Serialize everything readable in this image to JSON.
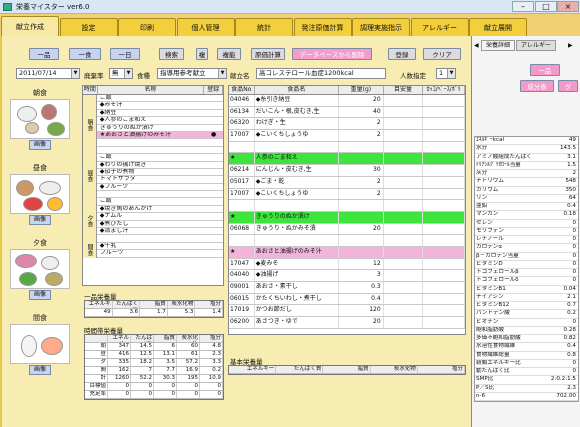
{
  "app": {
    "title": "栄養マイスター ver6.0",
    "min": "–",
    "max": "□",
    "close": "×"
  },
  "tabs": [
    "献立作成",
    "設定",
    "印刷",
    "個人管理",
    "統計",
    "発注原価計算",
    "調理実施指示",
    "アレルギー",
    "献立展開"
  ],
  "toolbar": {
    "b1": "一品",
    "b2": "一食",
    "b3": "一日",
    "b4": "検索",
    "b5": "複",
    "b6": "複能",
    "b7": "原価計算",
    "b8": "データベースから削除",
    "b9": "登録",
    "b10": "クリア"
  },
  "form": {
    "date": "2011/07/14",
    "waste_label": "廃棄率",
    "waste_val": "無",
    "type_label": "食種",
    "type_val": "指導用参考献立",
    "menu_label": "献立名",
    "menu_val": "高コレステロール血症1200kcal",
    "people_label": "人数指定",
    "people_val": "1"
  },
  "meals": [
    {
      "name": "朝食",
      "btn": "画像"
    },
    {
      "name": "昼食",
      "btn": "画像"
    },
    {
      "name": "夕食",
      "btn": "画像"
    },
    {
      "name": "間食",
      "btn": "画像"
    }
  ],
  "menu_grid": {
    "headers": [
      "時間",
      "名称",
      "登録"
    ],
    "groups": [
      "朝食",
      "昼食",
      "夕食",
      "間食"
    ],
    "rows": [
      "ご飯",
      "◆みそ汁",
      "◆納豆",
      "◆人参のごま和え",
      "きゅうりのぬか漬け",
      "★あおさと油揚げのみそ汁",
      "",
      "",
      "ご飯",
      "◆わりの揚げ焼き",
      "◆茄子の煮物",
      "トマトサラダ",
      "◆フルーツ",
      "",
      "ご飯",
      "◆焼き魚のあんかけ",
      "◆ナムル",
      "◆煮びたし",
      "◆清まし汁",
      "",
      "◆牛乳",
      "フルーツ"
    ]
  },
  "food_grid": {
    "headers": [
      "食品No",
      "食品名",
      "重量(g)",
      "目安量",
      "ｶｯｺ/ﾍﾞｰｽ/ﾎﾞﾘ"
    ],
    "rows": [
      {
        "no": "04046",
        "name": "◆糸引き納豆",
        "w": "20",
        "band": ""
      },
      {
        "no": "06134",
        "name": "だいこん・根,皮むき,生",
        "w": "40",
        "band": ""
      },
      {
        "no": "06320",
        "name": "わけぎ・生",
        "w": "2",
        "band": ""
      },
      {
        "no": "17007",
        "name": "◆こいくちしょうゆ",
        "w": "2",
        "band": ""
      },
      {
        "no": "",
        "name": "",
        "w": "",
        "band": ""
      },
      {
        "no": "★",
        "name": "人参のごま和え",
        "w": "",
        "band": "green"
      },
      {
        "no": "06214",
        "name": "にんじん・皮むき,生",
        "w": "30",
        "band": ""
      },
      {
        "no": "05017",
        "name": "◆ごま・乾",
        "w": "2",
        "band": ""
      },
      {
        "no": "17007",
        "name": "◆こいくちしょうゆ",
        "w": "2",
        "band": ""
      },
      {
        "no": "",
        "name": "",
        "w": "",
        "band": ""
      },
      {
        "no": "★",
        "name": "きゅうりのぬか漬け",
        "w": "",
        "band": "green"
      },
      {
        "no": "06068",
        "name": "きゅうり・ぬかみそ漬",
        "w": "20",
        "band": ""
      },
      {
        "no": "",
        "name": "",
        "w": "",
        "band": ""
      },
      {
        "no": "★",
        "name": "あおさと油揚げのみそ汁",
        "w": "",
        "band": "pink"
      },
      {
        "no": "17047",
        "name": "◆麦みそ",
        "w": "12",
        "band": ""
      },
      {
        "no": "04040",
        "name": "◆油揚げ",
        "w": "3",
        "band": ""
      },
      {
        "no": "09001",
        "name": "あおさ・素干し",
        "w": "0.3",
        "band": ""
      },
      {
        "no": "06015",
        "name": "かたくちいわし・煮干し",
        "w": "0.4",
        "band": ""
      },
      {
        "no": "17019",
        "name": "かつお節だし",
        "w": "120",
        "band": ""
      },
      {
        "no": "06200",
        "name": "あさつき・ゆで",
        "w": "20",
        "band": ""
      }
    ]
  },
  "ippin": {
    "title": "一品栄養量",
    "headers": [
      "エネルギー",
      "たんぱく質",
      "脂質",
      "炭水化物",
      "塩分"
    ],
    "values": [
      "49",
      "3.6",
      "1.7",
      "5.3",
      "1.4"
    ]
  },
  "jikan": {
    "title": "時間帯栄養量",
    "headers": [
      "",
      "エネルギー",
      "たんぱく質",
      "脂質",
      "炭水化物",
      "塩分"
    ],
    "rows": [
      [
        "朝",
        "347",
        "14.5",
        "6",
        "60",
        "4.8"
      ],
      [
        "昼",
        "416",
        "12.5",
        "13.1",
        "61",
        "2.3"
      ],
      [
        "夕",
        "335",
        "18.2",
        "3.5",
        "57.2",
        "3.3"
      ],
      [
        "間",
        "162",
        "7",
        "7.7",
        "16.9",
        "0.2"
      ],
      [
        "計",
        "1260",
        "52.2",
        "30.3",
        "195",
        "10.9"
      ],
      [
        "目標値",
        "0",
        "0",
        "0",
        "0",
        "0"
      ],
      [
        "充足率",
        "0",
        "0",
        "0",
        "0",
        "0"
      ]
    ]
  },
  "kihon": {
    "title": "基本栄養量",
    "headers": [
      "エネルギー",
      "たんぱく質",
      "脂質",
      "炭水化物",
      "塩分"
    ]
  },
  "right": {
    "tab1": "栄養詳細",
    "tab2": "アレルギー",
    "btn1": "一品",
    "btn2": "成分表",
    "btn3": "グ"
  },
  "nutrients": [
    [
      "ｴﾈﾙｷﾞｰkcal",
      "49"
    ],
    [
      "水分",
      "143.5"
    ],
    [
      "アミノ酸組成たんぱく",
      "3.1"
    ],
    [
      "ﾄﾘｱｼﾙｸﾞﾘｾﾛｰﾙ当量",
      "1.5"
    ],
    [
      "灰分",
      "2"
    ],
    [
      "ナトリウム",
      "548"
    ],
    [
      "カリウム",
      "350"
    ],
    [
      "リン",
      "64"
    ],
    [
      "亜鉛",
      "0.4"
    ],
    [
      "マンガン",
      "0.18"
    ],
    [
      "セレン",
      "0"
    ],
    [
      "モリブデン",
      "0"
    ],
    [
      "レチノール",
      "0"
    ],
    [
      "カロテンα",
      "0"
    ],
    [
      "β－カロテン当量",
      "0"
    ],
    [
      "ビタミンD",
      "0"
    ],
    [
      "トコフェロールβ",
      "0"
    ],
    [
      "トコフェロールδ",
      "0"
    ],
    [
      "ビタミンB1",
      "0.04"
    ],
    [
      "ナイアシン",
      "2.1"
    ],
    [
      "ビタミンB12",
      "0.7"
    ],
    [
      "パントテン酸",
      "0.2"
    ],
    [
      "ビオチン",
      "0"
    ],
    [
      "飽和脂肪酸",
      "0.28"
    ],
    [
      "多価不飽和脂肪酸",
      "0.82"
    ],
    [
      "水溶性食物繊維",
      "0.4"
    ],
    [
      "食物繊維総量",
      "0.8"
    ],
    [
      "穀類エネルギー比",
      "0"
    ],
    [
      "動たんぱく比",
      "0"
    ],
    [
      "SMP比",
      "2:0.2:1.5"
    ],
    [
      "P／S比",
      "2.3"
    ],
    [
      "n-6",
      "702.00"
    ]
  ]
}
